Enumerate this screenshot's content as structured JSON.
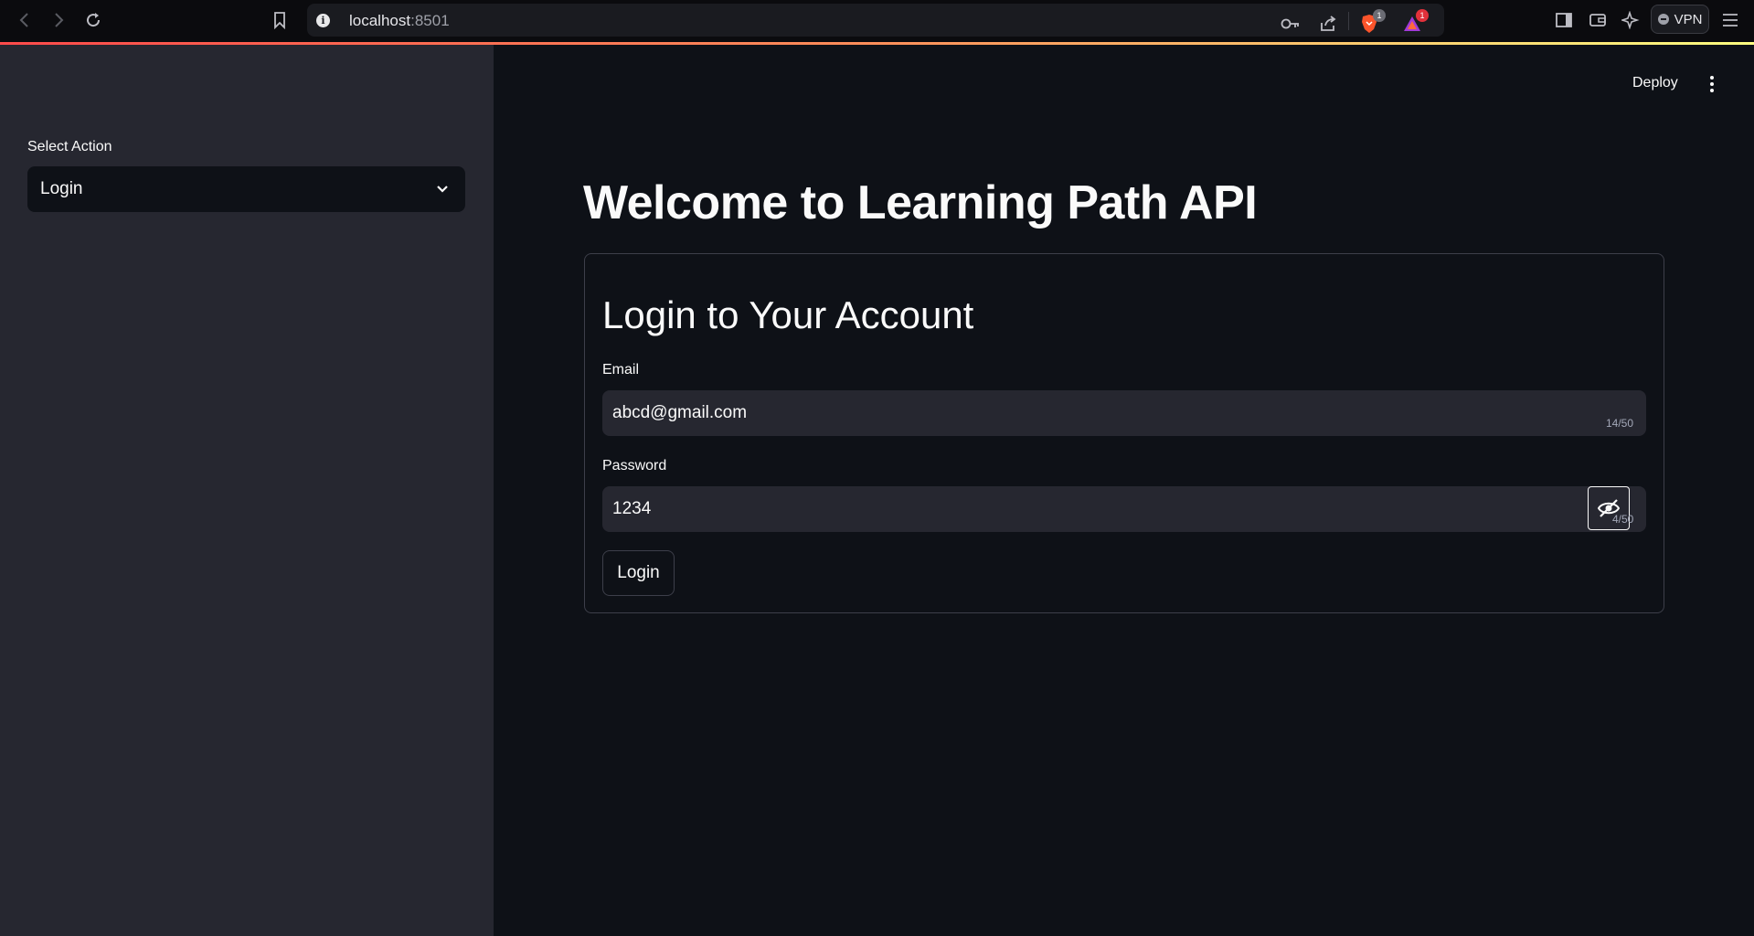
{
  "browser": {
    "url_host": "localhost",
    "url_port": ":8501",
    "brave_badge": "1",
    "rewards_badge": "1",
    "vpn_label": "VPN"
  },
  "sidebar": {
    "select_label": "Select Action",
    "select_value": "Login"
  },
  "header": {
    "deploy_label": "Deploy"
  },
  "main": {
    "title": "Welcome to Learning Path API",
    "form": {
      "title": "Login to Your Account",
      "email_label": "Email",
      "email_value": "abcd@gmail.com",
      "email_counter": "14/50",
      "password_label": "Password",
      "password_value": "1234",
      "password_counter": "4/50",
      "submit_label": "Login"
    }
  },
  "colors": {
    "background": "#0e1117",
    "sidebar": "#262730",
    "input": "#262730",
    "text": "#fafafa",
    "accent_gradient_start": "#ff4b4b",
    "accent_gradient_end": "#fffd80"
  }
}
